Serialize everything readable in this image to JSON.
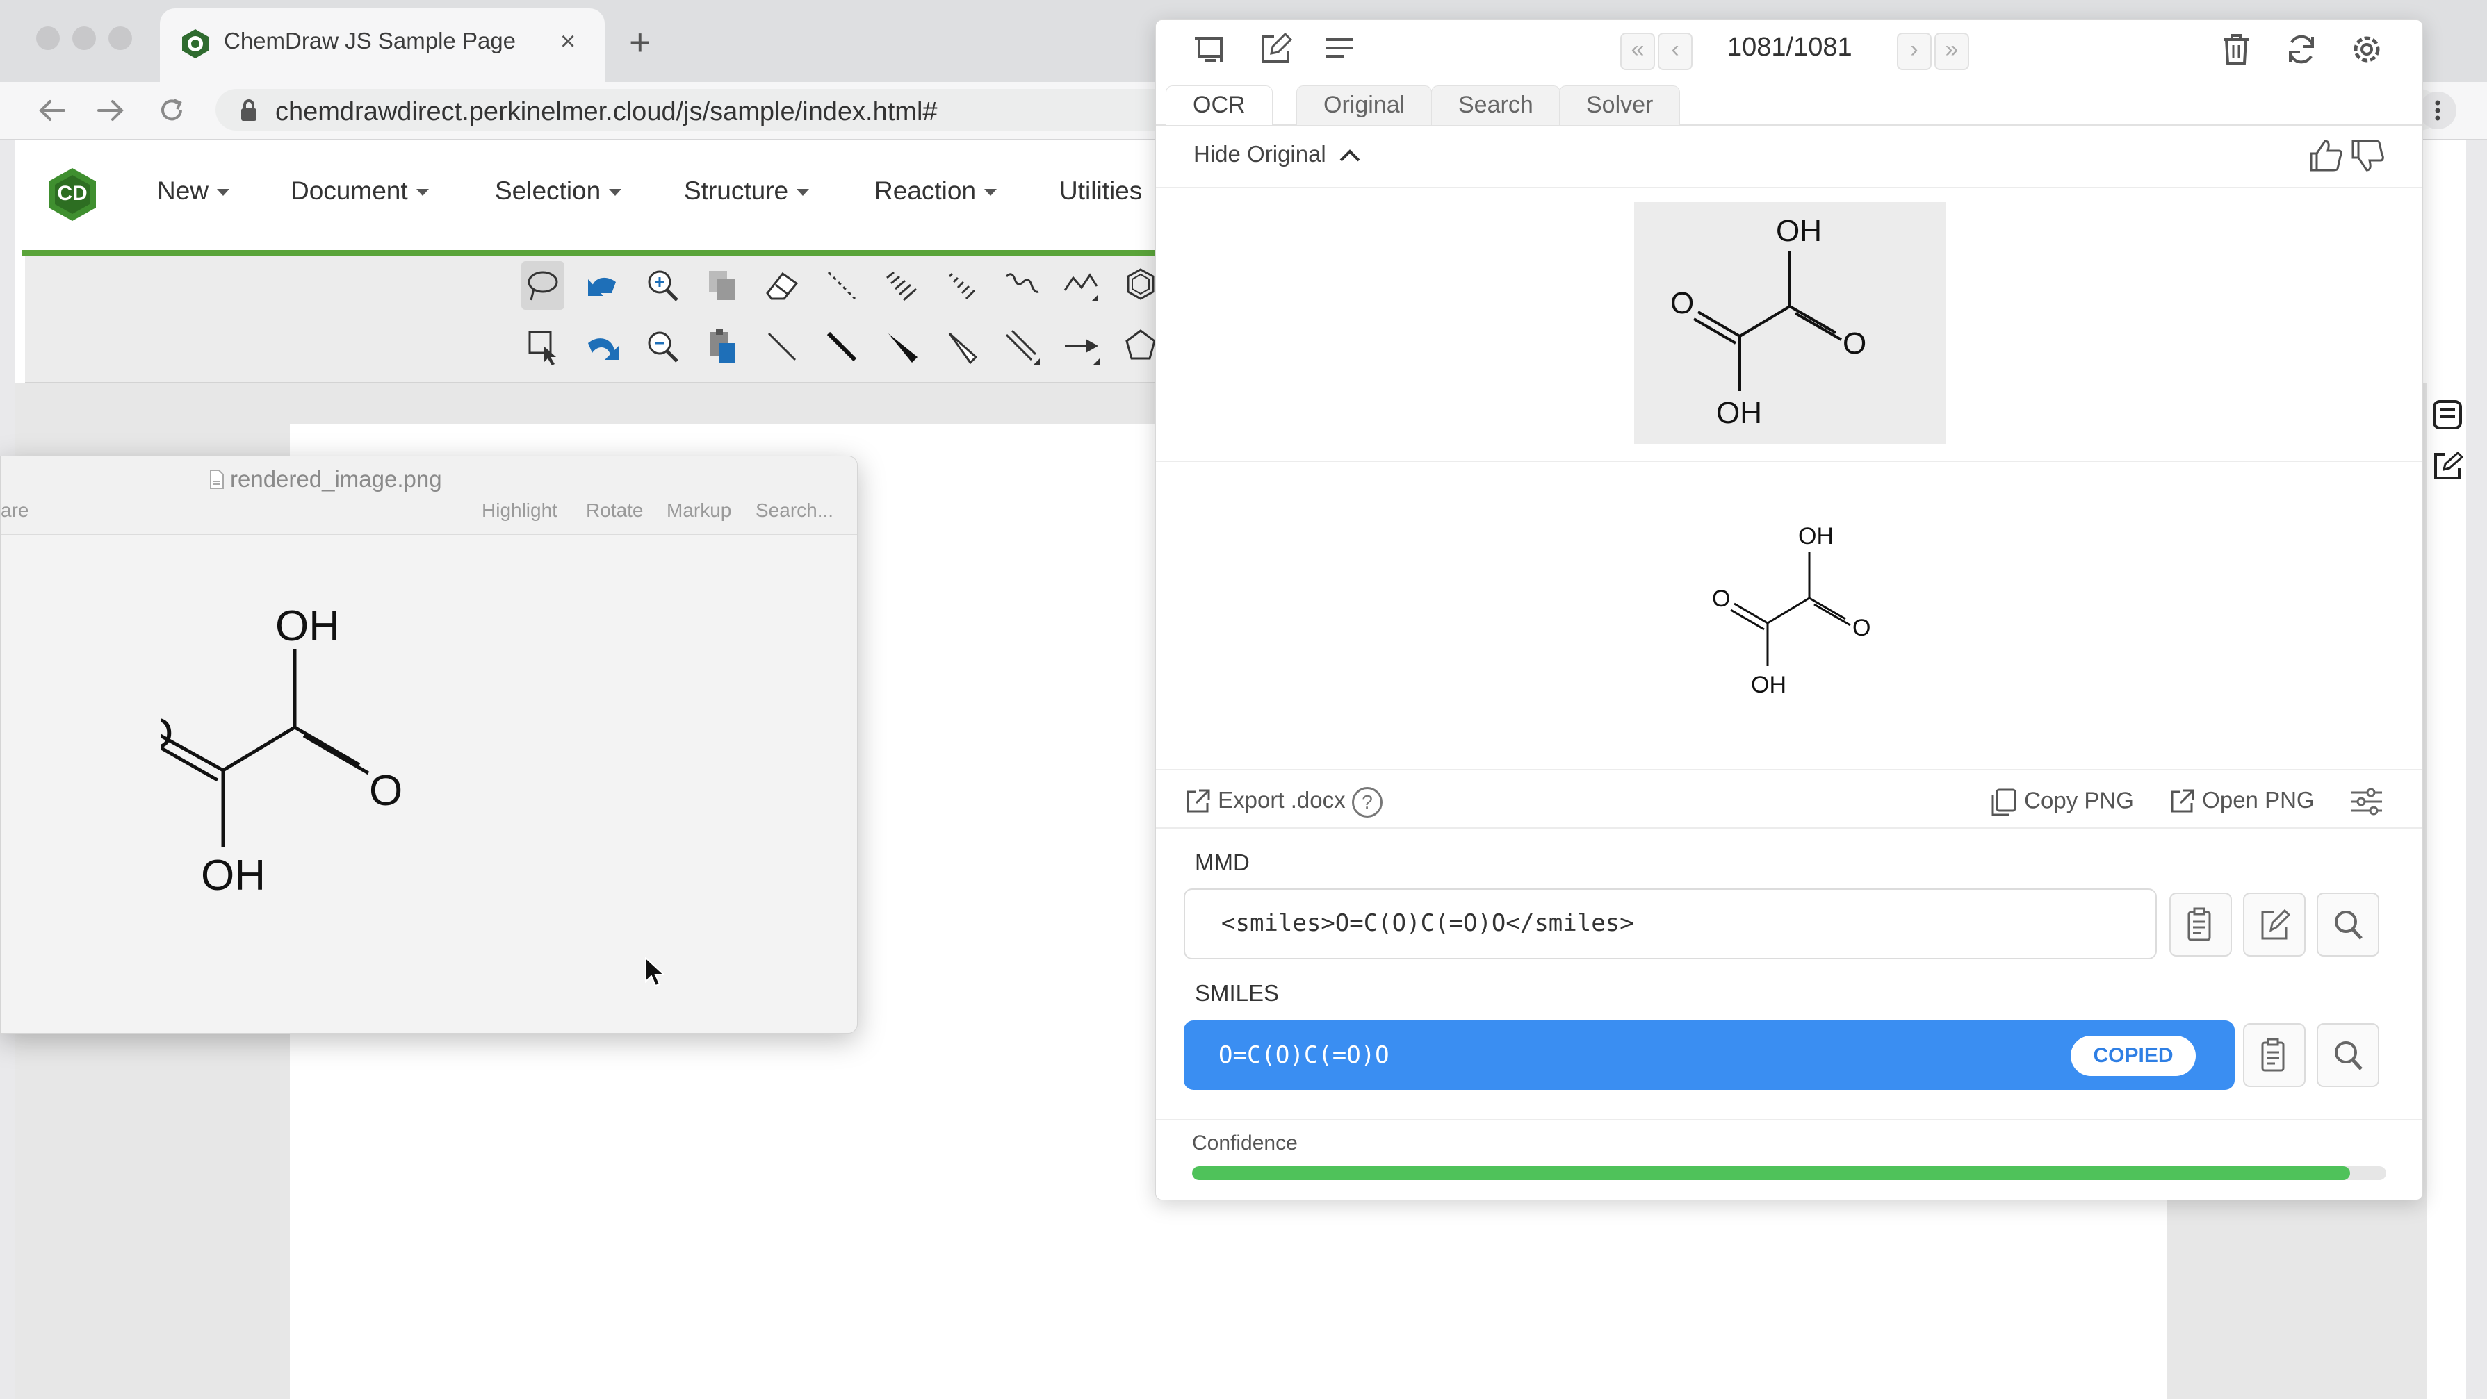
{
  "browser": {
    "tab_title": "ChemDraw JS Sample Page",
    "tab_close": "×",
    "new_tab": "+",
    "url": "chemdrawdirect.perkinelmer.cloud/js/sample/index.html#"
  },
  "app": {
    "logo_text": "CD",
    "menu": [
      "New",
      "Document",
      "Selection",
      "Structure",
      "Reaction",
      "Utilities"
    ]
  },
  "preview": {
    "title": "rendered_image.png",
    "share_partial": "are",
    "tools": [
      "Highlight",
      "Rotate",
      "Markup",
      "Search..."
    ]
  },
  "panel": {
    "counter": "1081/1081",
    "nav": {
      "first": "«",
      "prev": "‹",
      "next": "›",
      "last": "»"
    },
    "tabs": [
      "OCR",
      "Original",
      "Search",
      "Solver"
    ],
    "active_tab": "OCR",
    "hide_original": "Hide Original",
    "actions": {
      "export": "Export .docx",
      "help": "?",
      "copy_png": "Copy PNG",
      "open_png": "Open PNG"
    },
    "mmd_label": "MMD",
    "mmd_value": "<smiles>O=C(O)C(=O)O</smiles>",
    "smiles_label": "SMILES",
    "smiles_value": "O=C(O)C(=O)O",
    "copied_badge": "COPIED",
    "confidence_label": "Confidence",
    "confidence": 0.97
  },
  "molecule": {
    "atom_labels": [
      "OH",
      "O",
      "O",
      "OH"
    ]
  },
  "colors": {
    "accent_blue": "#3a8ef2",
    "confidence_green": "#4fc25a",
    "chemdraw_green": "#5aa43a"
  }
}
